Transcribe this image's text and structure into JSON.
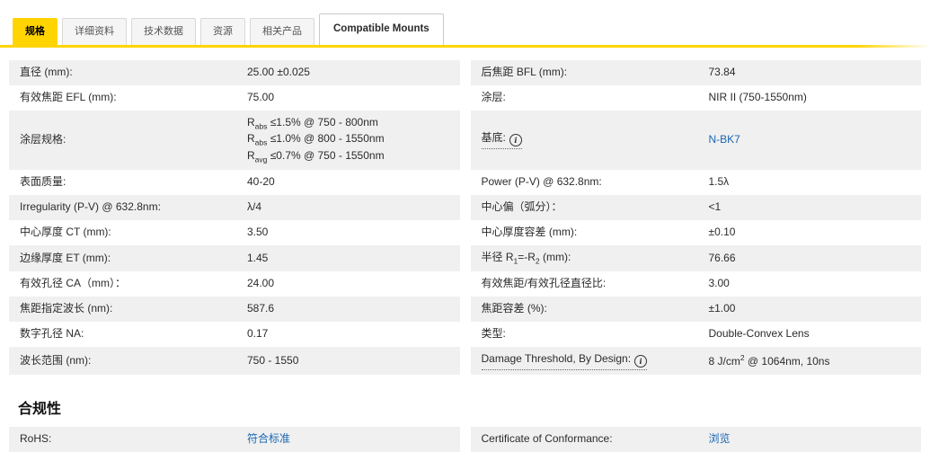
{
  "tabs": {
    "items": [
      {
        "label": "规格",
        "state": "active"
      },
      {
        "label": "详细资料",
        "state": "normal"
      },
      {
        "label": "技术数据",
        "state": "normal"
      },
      {
        "label": "资源",
        "state": "normal"
      },
      {
        "label": "相关产品",
        "state": "normal"
      },
      {
        "label": "Compatible Mounts",
        "state": "emphasized"
      }
    ]
  },
  "colors": {
    "accent_yellow": "#ffd400",
    "link_blue": "#1a66b3",
    "stripe_gray": "#f0f0f0"
  },
  "icons": {
    "info_glyph": "i"
  },
  "spec": {
    "pairs": [
      {
        "left": {
          "label": "直径 (mm):",
          "value": "25.00 ±0.025"
        },
        "right": {
          "label": "后焦距 BFL (mm):",
          "value": "73.84"
        }
      },
      {
        "left": {
          "label": "有效焦距 EFL (mm):",
          "value": "75.00"
        },
        "right": {
          "label": "涂层:",
          "value": "NIR II (750-1550nm)"
        }
      },
      {
        "left": {
          "label": "涂层规格:",
          "value": "R~abs~ ≤1.5% @ 750 - 800nm\nR~abs~ ≤1.0% @ 800 - 1550nm\nR~avg~ ≤0.7% @ 750 - 1550nm"
        },
        "right": {
          "label": "基底:",
          "info": true,
          "value": "N-BK7",
          "link": true
        }
      },
      {
        "left": {
          "label": "表面质量:",
          "value": "40-20"
        },
        "right": {
          "label": "Power (P-V) @ 632.8nm:",
          "value": "1.5λ"
        }
      },
      {
        "left": {
          "label": "Irregularity (P-V) @ 632.8nm:",
          "value": "λ/4"
        },
        "right": {
          "label": "中心偏（弧分）：",
          "value": "<1"
        }
      },
      {
        "left": {
          "label": "中心厚度 CT (mm):",
          "value": "3.50"
        },
        "right": {
          "label": "中心厚度容差 (mm):",
          "value": "±0.10"
        }
      },
      {
        "left": {
          "label": "边缘厚度 ET (mm):",
          "value": "1.45"
        },
        "right": {
          "label": "半径 R~1~=-R~2~ (mm):",
          "value": "76.66"
        }
      },
      {
        "left": {
          "label": "有效孔径 CA（mm）：",
          "value": "24.00"
        },
        "right": {
          "label": "有效焦距/有效孔径直径比:",
          "value": "3.00"
        }
      },
      {
        "left": {
          "label": "焦距指定波长 (nm):",
          "value": "587.6"
        },
        "right": {
          "label": "焦距容差 (%):",
          "value": "±1.00"
        }
      },
      {
        "left": {
          "label": "数字孔径 NA:",
          "value": "0.17"
        },
        "right": {
          "label": "类型:",
          "value": "Double-Convex Lens"
        }
      },
      {
        "left": {
          "label": "波长范围 (nm):",
          "value": "750 - 1550"
        },
        "right": {
          "label": "Damage Threshold, By Design:",
          "info": true,
          "value": "8 J/cm^2^ @ 1064nm, 10ns"
        }
      }
    ]
  },
  "compliance": {
    "heading": "合规性",
    "pairs": [
      {
        "left": {
          "label": "RoHS:",
          "value": "符合标准",
          "link": true
        },
        "right": {
          "label": "Certificate of Conformance:",
          "value": "浏览",
          "link": true
        }
      }
    ]
  }
}
